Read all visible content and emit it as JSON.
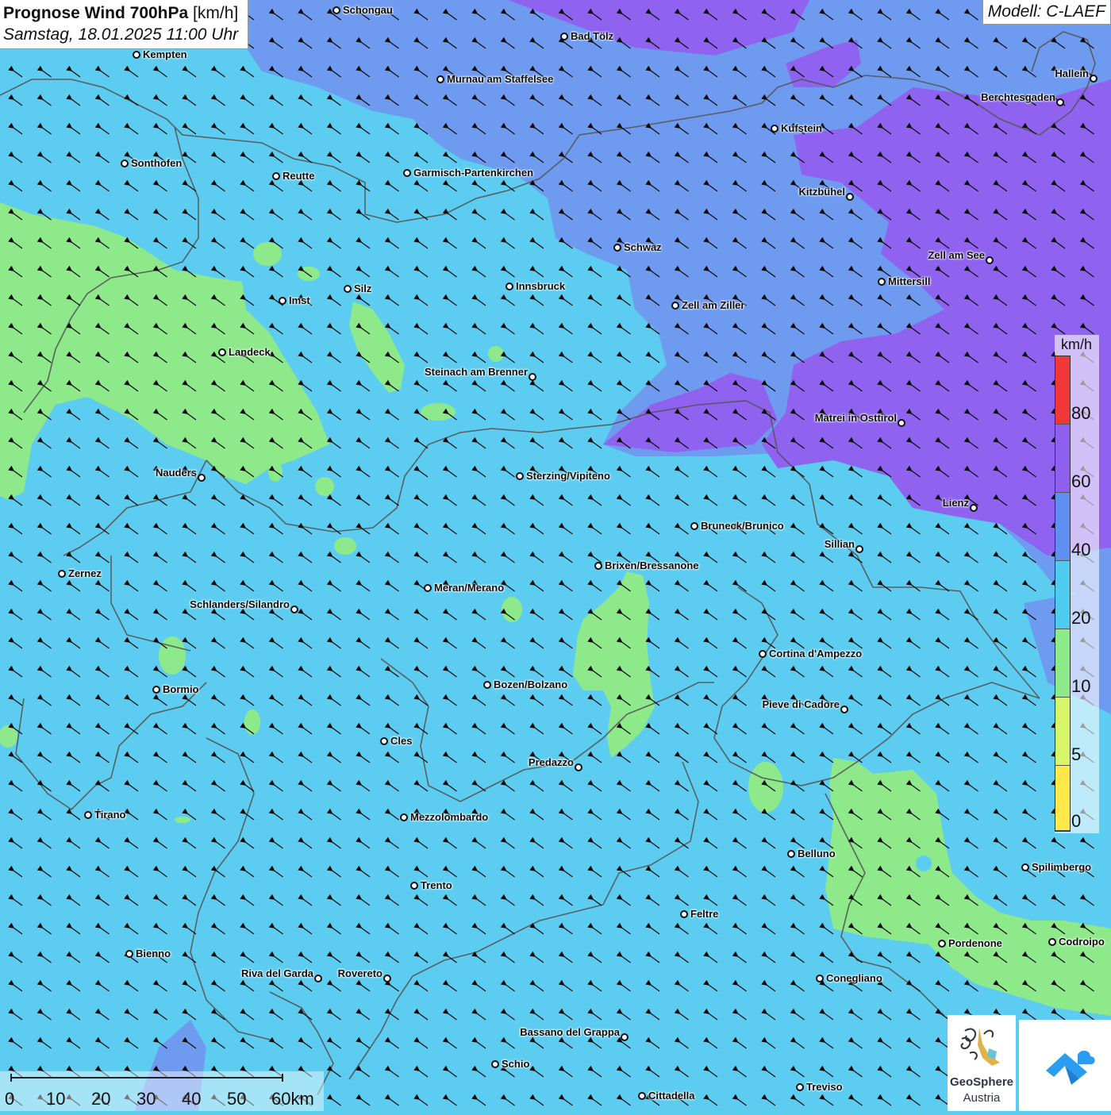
{
  "header": {
    "title_bold": "Prognose Wind 700hPa",
    "title_unit": "[km/h]",
    "datetime": "Samstag, 18.01.2025 11:00 Uhr",
    "model": "Modell: C-LAEF"
  },
  "legend": {
    "unit": "km/h",
    "ticks": [
      "80",
      "60",
      "40",
      "20",
      "10",
      "5",
      "0"
    ],
    "colors": [
      "#ffe84a",
      "#d7f56a",
      "#8ee98a",
      "#50cbf0",
      "#5f8ff0",
      "#8f60f0",
      "#f03838",
      "#f0f0ff"
    ]
  },
  "scalebar": {
    "labels": [
      "0",
      "10",
      "20",
      "30",
      "40",
      "50",
      "60km"
    ]
  },
  "logo": {
    "name": "GeoSphere",
    "sub": "Austria",
    "icon": "geosphere-logo-icon"
  },
  "cities": [
    {
      "name": "Schongau",
      "side": "right"
    },
    {
      "name": "Bad Tölz",
      "side": "right"
    },
    {
      "name": "Kempten",
      "side": "right"
    },
    {
      "name": "Murnau am Staffelsee",
      "side": "right"
    },
    {
      "name": "Hallein",
      "side": "left"
    },
    {
      "name": "Berchtesgaden",
      "side": "left"
    },
    {
      "name": "Kufstein",
      "side": "right"
    },
    {
      "name": "Sonthofen",
      "side": "right"
    },
    {
      "name": "Reutte",
      "side": "right"
    },
    {
      "name": "Garmisch-Partenkirchen",
      "side": "right"
    },
    {
      "name": "Kitzbühel",
      "side": "left"
    },
    {
      "name": "Schwaz",
      "side": "right"
    },
    {
      "name": "Zell am See",
      "side": "left"
    },
    {
      "name": "Mittersill",
      "side": "right"
    },
    {
      "name": "Innsbruck",
      "side": "right"
    },
    {
      "name": "Silz",
      "side": "right"
    },
    {
      "name": "Imst",
      "side": "right"
    },
    {
      "name": "Zell am Ziller",
      "side": "right"
    },
    {
      "name": "Landeck",
      "side": "right"
    },
    {
      "name": "Steinach am Brenner",
      "side": "left"
    },
    {
      "name": "Matrei in Osttirol",
      "side": "left"
    },
    {
      "name": "Nauders",
      "side": "left"
    },
    {
      "name": "Sterzing/Vipiteno",
      "side": "right"
    },
    {
      "name": "Lienz",
      "side": "left"
    },
    {
      "name": "Bruneck/Brunico",
      "side": "right"
    },
    {
      "name": "Sillian",
      "side": "left"
    },
    {
      "name": "Brixen/Bressanone",
      "side": "right"
    },
    {
      "name": "Zernez",
      "side": "right"
    },
    {
      "name": "Meran/Merano",
      "side": "right"
    },
    {
      "name": "Schlanders/Silandro",
      "side": "left"
    },
    {
      "name": "Cortina d'Ampezzo",
      "side": "right"
    },
    {
      "name": "Bozen/Bolzano",
      "side": "right"
    },
    {
      "name": "Bormio",
      "side": "right"
    },
    {
      "name": "Pieve di Cadore",
      "side": "left"
    },
    {
      "name": "Cles",
      "side": "right"
    },
    {
      "name": "Predazzo",
      "side": "left"
    },
    {
      "name": "Tirano",
      "side": "right"
    },
    {
      "name": "Mezzolombardo",
      "side": "right"
    },
    {
      "name": "Belluno",
      "side": "right"
    },
    {
      "name": "Spilimbergo",
      "side": "right"
    },
    {
      "name": "Trento",
      "side": "right"
    },
    {
      "name": "Feltre",
      "side": "right"
    },
    {
      "name": "Pordenone",
      "side": "right"
    },
    {
      "name": "Codroipo",
      "side": "right"
    },
    {
      "name": "Bienno",
      "side": "right"
    },
    {
      "name": "Riva del Garda",
      "side": "left"
    },
    {
      "name": "Rovereto",
      "side": "left"
    },
    {
      "name": "Conegliano",
      "side": "right"
    },
    {
      "name": "Bassano del Grappa",
      "side": "left"
    },
    {
      "name": "Schio",
      "side": "right"
    },
    {
      "name": "Treviso",
      "side": "right"
    },
    {
      "name": "Cittadella",
      "side": "right"
    }
  ]
}
